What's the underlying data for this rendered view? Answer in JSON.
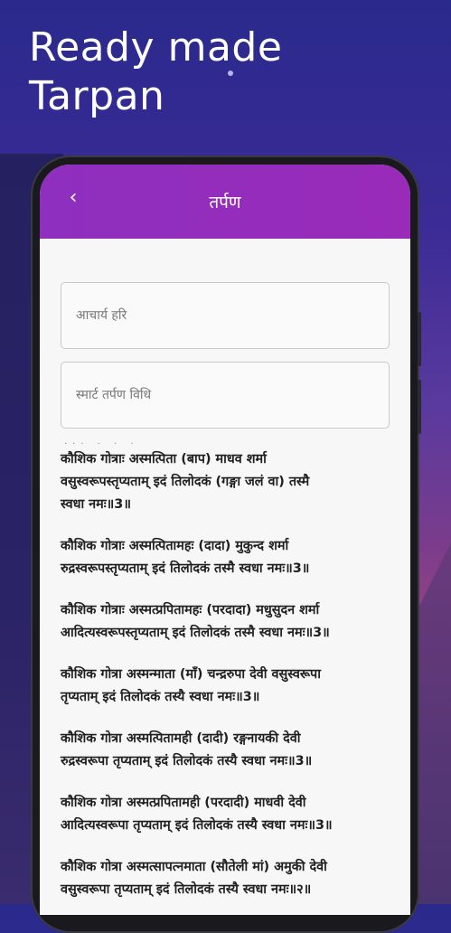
{
  "promo": {
    "title_line1": "Ready made",
    "title_line2": "Tarpan"
  },
  "app_bar": {
    "back_icon": "chevron-left-icon",
    "title": "तर्पण",
    "color": "#9a2bb9"
  },
  "inputs": [
    {
      "placeholder": "आचार्य हरि"
    },
    {
      "placeholder": "स्मार्ट तर्पण विधि"
    }
  ],
  "verses": [
    {
      "line1": "कौशिक गोत्राः अस्मत्पिता (बाप) माधव शर्मा",
      "line2": "वसुस्वरूपस्तृप्यताम् इदं तिलोदकं (गङ्गा जलं वा) तस्मै",
      "line3": "स्वधा नमः॥3॥"
    },
    {
      "line1": "कौशिक गोत्राः अस्मत्पितामहः (दादा) मुकुन्द शर्मा",
      "line2": "रुद्रस्वरूपस्तृप्यताम् इदं तिलोदकं तस्मै स्वधा नमः॥3॥",
      "line3": ""
    },
    {
      "line1": "कौशिक गोत्राः अस्मत्प्रपितामहः (परदादा) मधुसुदन शर्मा",
      "line2": "आदित्यस्वरूपस्तृप्यताम् इदं तिलोदकं तस्मै स्वधा नमः॥3॥",
      "line3": ""
    },
    {
      "line1": "कौशिक गोत्रा अस्मन्माता (माँ) चन्द्ररुपा देवी वसुस्वरूपा",
      "line2": "तृप्यताम् इदं तिलोदकं तस्यै स्वधा नमः॥3॥",
      "line3": ""
    },
    {
      "line1": "कौशिक गोत्रा अस्मत्पितामही (दादी) रङ्गनायकी देवी",
      "line2": "रुद्रस्वरूपा तृप्यताम् इदं तिलोदकं तस्यै स्वधा नमः॥3॥",
      "line3": ""
    },
    {
      "line1": "कौशिक गोत्रा अस्मत्प्रपितामही (परदादी) माधवी देवी",
      "line2": "आदित्यस्वरूपा तृप्यताम् इदं तिलोदकं तस्यै स्वधा नमः॥3॥",
      "line3": ""
    },
    {
      "line1": "कौशिक गोत्रा अस्मत्सापत्नमाता (सौतेली मां) अमुकी देवी",
      "line2": "वसुस्वरूपा तृप्यताम् इदं तिलोदकं तस्यै स्वधा नमः॥२॥",
      "line3": ""
    }
  ]
}
